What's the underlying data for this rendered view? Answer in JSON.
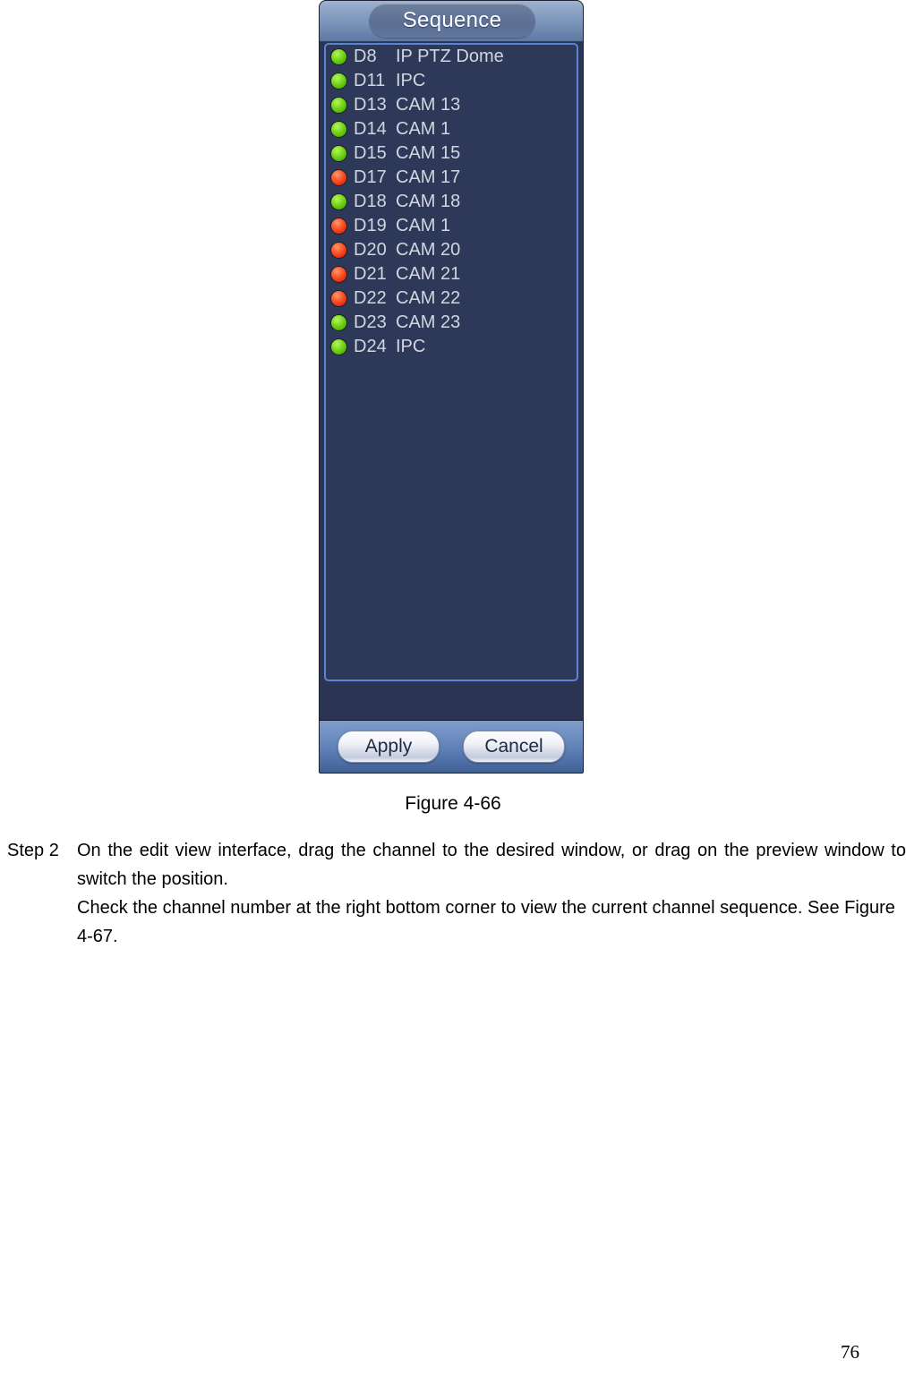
{
  "dialog": {
    "title": "Sequence",
    "channels": [
      {
        "id": "D8",
        "name": "IP PTZ Dome",
        "status": "green"
      },
      {
        "id": "D11",
        "name": "IPC",
        "status": "green"
      },
      {
        "id": "D13",
        "name": "CAM 13",
        "status": "green"
      },
      {
        "id": "D14",
        "name": "CAM 1",
        "status": "green"
      },
      {
        "id": "D15",
        "name": "CAM 15",
        "status": "green"
      },
      {
        "id": "D17",
        "name": "CAM 17",
        "status": "red"
      },
      {
        "id": "D18",
        "name": "CAM 18",
        "status": "green"
      },
      {
        "id": "D19",
        "name": "CAM 1",
        "status": "red"
      },
      {
        "id": "D20",
        "name": "CAM 20",
        "status": "red"
      },
      {
        "id": "D21",
        "name": "CAM 21",
        "status": "red"
      },
      {
        "id": "D22",
        "name": "CAM 22",
        "status": "red"
      },
      {
        "id": "D23",
        "name": "CAM 23",
        "status": "green"
      },
      {
        "id": "D24",
        "name": "IPC",
        "status": "green"
      }
    ],
    "buttons": {
      "apply": "Apply",
      "cancel": "Cancel"
    },
    "colors": {
      "led_online": "#5fc310",
      "led_offline": "#ef3a14",
      "panel_background": "#2e3858",
      "panel_border": "#5d84d4",
      "titlebar": "#7b94ba",
      "footer": "#5c7db4"
    }
  },
  "document": {
    "figure_caption": "Figure 4-66",
    "step": {
      "label": "Step 2",
      "paragraphs": [
        "On the edit view interface, drag the channel to the desired window, or drag on the preview window to switch the position.",
        "Check the channel number at the right bottom corner to view the current channel sequence. See Figure 4-67."
      ]
    },
    "page_number": "76"
  }
}
